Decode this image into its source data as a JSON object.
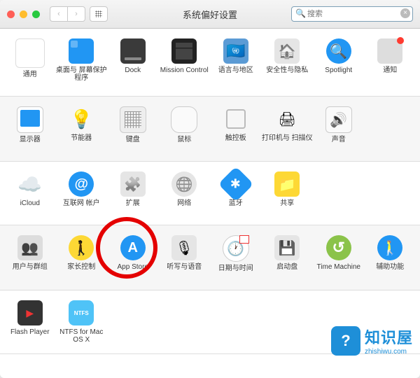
{
  "window": {
    "title": "系统偏好设置"
  },
  "search": {
    "placeholder": "搜索"
  },
  "rows": [
    {
      "alt": false,
      "items": [
        {
          "icon": "general",
          "name": "general-icon",
          "label": "通用"
        },
        {
          "icon": "desktop",
          "name": "desktop-icon",
          "label": "桌面与\n屏幕保护程序"
        },
        {
          "icon": "dock",
          "name": "dock-icon",
          "label": "Dock"
        },
        {
          "icon": "mission",
          "name": "mission-control-icon",
          "label": "Mission\nControl"
        },
        {
          "icon": "lang",
          "name": "language-region-icon",
          "label": "语言与地区"
        },
        {
          "icon": "security",
          "name": "security-privacy-icon",
          "label": "安全性与隐私"
        },
        {
          "icon": "spotlight",
          "name": "spotlight-icon",
          "label": "Spotlight"
        },
        {
          "icon": "notif",
          "name": "notifications-icon",
          "label": "通知"
        }
      ]
    },
    {
      "alt": true,
      "items": [
        {
          "icon": "display",
          "name": "displays-icon",
          "label": "显示器"
        },
        {
          "icon": "energy",
          "name": "energy-saver-icon",
          "label": "节能器"
        },
        {
          "icon": "keyboard",
          "name": "keyboard-icon",
          "label": "键盘"
        },
        {
          "icon": "mouse",
          "name": "mouse-icon",
          "label": "鼠标"
        },
        {
          "icon": "trackpad",
          "name": "trackpad-icon",
          "label": "触控板"
        },
        {
          "icon": "printer",
          "name": "printers-scanners-icon",
          "label": "打印机与\n扫描仪"
        },
        {
          "icon": "sound",
          "name": "sound-icon",
          "label": "声音"
        }
      ]
    },
    {
      "alt": false,
      "items": [
        {
          "icon": "icloud",
          "name": "icloud-icon",
          "label": "iCloud"
        },
        {
          "icon": "internet",
          "name": "internet-accounts-icon",
          "label": "互联网\n帐户"
        },
        {
          "icon": "ext",
          "name": "extensions-icon",
          "label": "扩展"
        },
        {
          "icon": "network",
          "name": "network-icon",
          "label": "网络"
        },
        {
          "icon": "bluetooth",
          "name": "bluetooth-icon",
          "label": "蓝牙"
        },
        {
          "icon": "sharing",
          "name": "sharing-icon",
          "label": "共享"
        }
      ]
    },
    {
      "alt": true,
      "items": [
        {
          "icon": "users",
          "name": "users-groups-icon",
          "label": "用户与群组"
        },
        {
          "icon": "parental",
          "name": "parental-controls-icon",
          "label": "家长控制"
        },
        {
          "icon": "appstore",
          "name": "app-store-icon",
          "label": "App Store"
        },
        {
          "icon": "dictation",
          "name": "dictation-speech-icon",
          "label": "听写与语音"
        },
        {
          "icon": "datetime",
          "name": "date-time-icon",
          "label": "日期与时间"
        },
        {
          "icon": "startup",
          "name": "startup-disk-icon",
          "label": "启动盘"
        },
        {
          "icon": "timemachine",
          "name": "time-machine-icon",
          "label": "Time Machine"
        },
        {
          "icon": "a11y",
          "name": "accessibility-icon",
          "label": "辅助功能"
        }
      ]
    },
    {
      "alt": false,
      "items": [
        {
          "icon": "flash",
          "name": "flash-player-icon",
          "label": "Flash Player"
        },
        {
          "icon": "ntfs",
          "name": "ntfs-icon",
          "label": "NTFS for\nMac OS X"
        }
      ]
    }
  ],
  "watermark": {
    "title": "知识屋",
    "url": "zhishiwu.com",
    "badge": "?"
  }
}
